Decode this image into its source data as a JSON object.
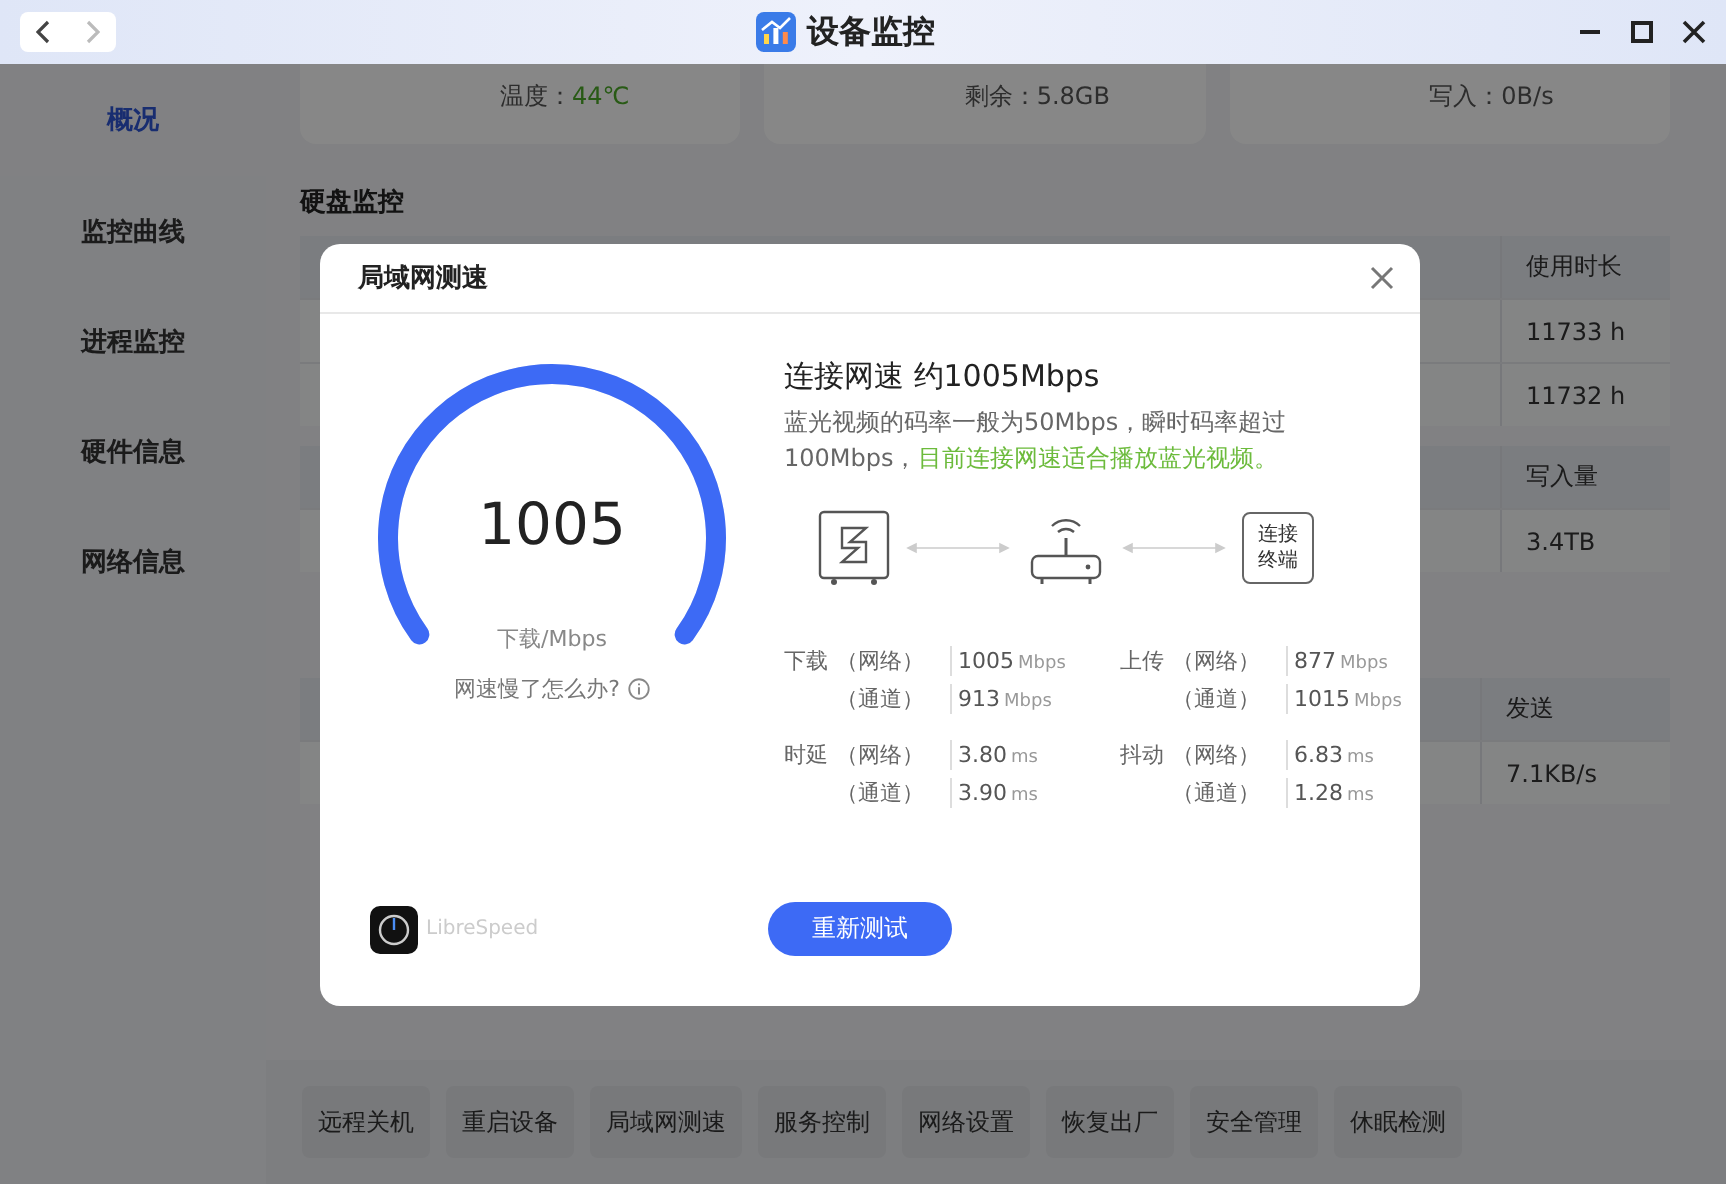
{
  "window": {
    "title": "设备监控"
  },
  "sidebar": {
    "items": [
      {
        "label": "概况",
        "selected": true
      },
      {
        "label": "监控曲线",
        "selected": false
      },
      {
        "label": "进程监控",
        "selected": false
      },
      {
        "label": "硬件信息",
        "selected": false
      },
      {
        "label": "网络信息",
        "selected": false
      }
    ]
  },
  "status_cards": [
    {
      "label": "温度：",
      "value": "44℃",
      "kind": "good"
    },
    {
      "label": "剩余：",
      "value": "5.8GB",
      "kind": "plain"
    },
    {
      "label": "写入：",
      "value": "0B/s",
      "kind": "plain"
    }
  ],
  "disk_section": {
    "title": "硬盘监控",
    "tables": [
      {
        "header": "使用时长",
        "rows": [
          "11733 h",
          "11732 h"
        ]
      },
      {
        "header": "写入量",
        "rows": [
          "3.4TB"
        ]
      }
    ]
  },
  "network_section": {
    "table": {
      "header": "发送",
      "rows": [
        "7.1KB/s"
      ]
    }
  },
  "actions": [
    "远程关机",
    "重启设备",
    "局域网测速",
    "服务控制",
    "网络设置",
    "恢复出厂",
    "安全管理",
    "休眠检测"
  ],
  "dialog": {
    "title": "局域网测速",
    "gauge": {
      "value": "1005",
      "unit": "下载/Mbps",
      "level": 1,
      "help": "网速慢了怎么办?"
    },
    "summary": {
      "title": "连接网速 约1005Mbps",
      "description": "蓝光视频的码率一般为50Mbps，瞬时码率超过100Mbps，",
      "verdict": "目前连接网速适合播放蓝光视频。"
    },
    "terminal_label": "连接终端",
    "stats": [
      {
        "metric": "下载",
        "rows": [
          {
            "channel": "（网络）",
            "value": "1005",
            "unit": "Mbps"
          },
          {
            "channel": "（通道）",
            "value": "913",
            "unit": "Mbps"
          }
        ]
      },
      {
        "metric": "上传",
        "rows": [
          {
            "channel": "（网络）",
            "value": "877",
            "unit": "Mbps"
          },
          {
            "channel": "（通道）",
            "value": "1015",
            "unit": "Mbps"
          }
        ]
      },
      {
        "metric": "时延",
        "rows": [
          {
            "channel": "（网络）",
            "value": "3.80",
            "unit": "ms"
          },
          {
            "channel": "（通道）",
            "value": "3.90",
            "unit": "ms"
          }
        ]
      },
      {
        "metric": "抖动",
        "rows": [
          {
            "channel": "（网络）",
            "value": "6.83",
            "unit": "ms"
          },
          {
            "channel": "（通道）",
            "value": "1.28",
            "unit": "ms"
          }
        ]
      }
    ],
    "brand": "LibreSpeed",
    "button": "重新测试"
  }
}
